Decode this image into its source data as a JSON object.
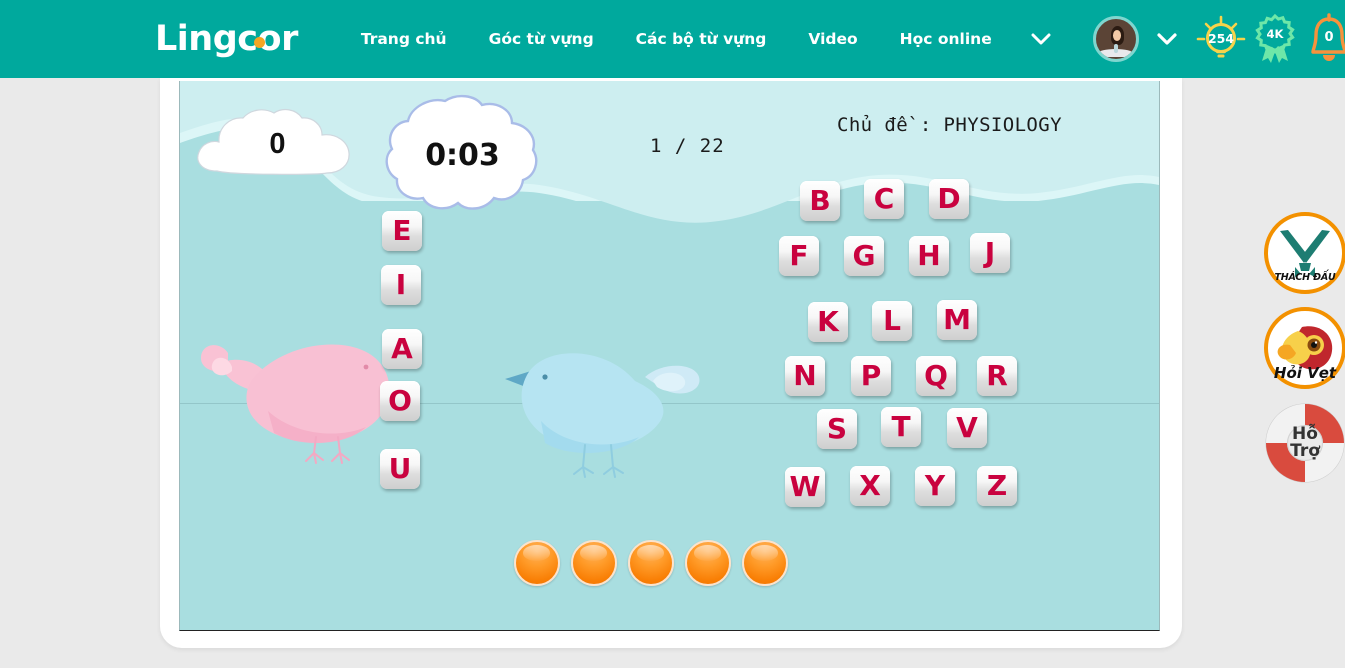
{
  "header": {
    "logo_text": "Lingcor",
    "logo_dot_color": "#f5a623",
    "bg_color": "#00a99d",
    "nav": [
      {
        "label": "Trang chủ",
        "name": "nav-trang-chu"
      },
      {
        "label": "Góc từ vựng",
        "name": "nav-goc-tu-vung"
      },
      {
        "label": "Các bộ từ vựng",
        "name": "nav-cac-bo-tu-vung"
      },
      {
        "label": "Video",
        "name": "nav-video"
      },
      {
        "label": "Học online",
        "name": "nav-hoc-online"
      }
    ],
    "nav_caret_icon": "chevron-down-icon",
    "avatar_icon": "user-avatar",
    "account_caret_icon": "chevron-down-icon",
    "bulb": {
      "icon": "lightbulb-icon",
      "value": "254",
      "color": "#f7d34a"
    },
    "medal": {
      "icon": "ribbon-badge-icon",
      "value": "4K",
      "color": "#6ee7a8"
    },
    "bell": {
      "icon": "bell-icon",
      "value": "0",
      "color": "#f7923c"
    }
  },
  "game": {
    "score": "0",
    "timer": "0:03",
    "progress": "1 / 22",
    "topic": "Chủ đề : PHYSIOLOGY",
    "bg_sky": "#dcf6f7",
    "bg_ground": "#a9dee0",
    "letter_color": "#c9023f",
    "vowels": [
      "E",
      "I",
      "A",
      "O",
      "U"
    ],
    "consonant_rows": [
      [
        "B",
        "C",
        "D"
      ],
      [
        "F",
        "G",
        "H",
        "J"
      ],
      [
        "K",
        "L",
        "M"
      ],
      [
        "N",
        "P",
        "Q",
        "R"
      ],
      [
        "S",
        "T",
        "V"
      ],
      [
        "W",
        "X",
        "Y",
        "Z"
      ]
    ],
    "answer_slots": 5,
    "slot_color": "#f97f05",
    "birds": [
      {
        "name": "bird-pink",
        "color": "#f9c2d4"
      },
      {
        "name": "bird-blue",
        "color": "#b6e4f2"
      }
    ]
  },
  "float_buttons": [
    {
      "name": "thach-dau-button",
      "icon": "crossed-swords-icon",
      "caption": "THÁCH ĐẤU"
    },
    {
      "name": "hoi-vet-button",
      "icon": "parrot-icon",
      "caption": "Hỏi Vẹt"
    },
    {
      "name": "ho-tro-button",
      "icon": "lifebuoy-icon",
      "caption_line1": "Hỗ",
      "caption_line2": "Trợ"
    }
  ]
}
